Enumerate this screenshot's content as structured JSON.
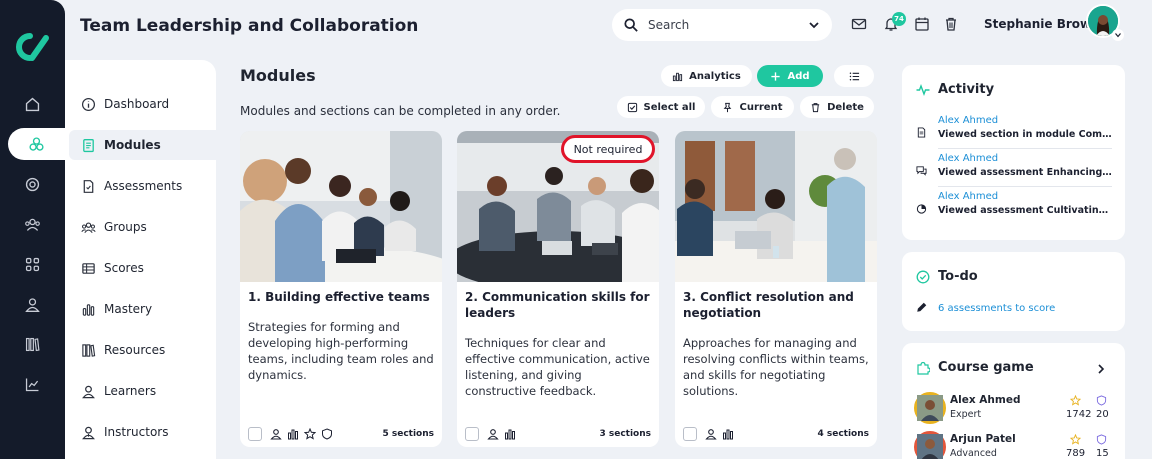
{
  "header": {
    "title": "Team Leadership and Collaboration",
    "search_placeholder": "Search",
    "notification_count": "74",
    "user_name": "Stephanie Brown"
  },
  "rail": {
    "items": [
      "home-icon",
      "modules-icon",
      "target-icon",
      "users-icon",
      "grid-icon",
      "person-icon",
      "library-icon",
      "chart-icon"
    ],
    "active": "modules-icon"
  },
  "subnav": {
    "items": [
      {
        "label": "Dashboard",
        "icon": "info-icon"
      },
      {
        "label": "Modules",
        "icon": "document-icon",
        "active": true
      },
      {
        "label": "Assessments",
        "icon": "assessment-icon"
      },
      {
        "label": "Groups",
        "icon": "groups-icon"
      },
      {
        "label": "Scores",
        "icon": "scores-icon"
      },
      {
        "label": "Mastery",
        "icon": "bars-icon"
      },
      {
        "label": "Resources",
        "icon": "books-icon"
      },
      {
        "label": "Learners",
        "icon": "user-icon"
      },
      {
        "label": "Instructors",
        "icon": "instructor-icon"
      }
    ]
  },
  "main": {
    "title": "Modules",
    "subtitle": "Modules and sections can be completed in any order.",
    "buttons": {
      "analytics": "Analytics",
      "add": "Add",
      "select_all": "Select all",
      "current": "Current",
      "delete": "Delete"
    },
    "cards": [
      {
        "title": "1. Building effective teams",
        "description": "Strategies for forming and developing high-performing teams, including team roles and dynamics.",
        "sections": "5 sections",
        "tag": ""
      },
      {
        "title": "2. Communication skills for leaders",
        "description": "Techniques for clear and effective communication, active listening, and giving constructive feedback.",
        "sections": "3 sections",
        "tag": "Not required"
      },
      {
        "title": "3. Conflict resolution and negotiation",
        "description": "Approaches for managing and resolving conflicts within teams, and skills for negotiating solutions.",
        "sections": "4 sections",
        "tag": ""
      }
    ]
  },
  "activity": {
    "title": "Activity",
    "items": [
      {
        "name": "Alex Ahmed",
        "description": "Viewed section in module Communication skills for leaders",
        "icon": "doc-icon"
      },
      {
        "name": "Alex Ahmed",
        "description": "Viewed assessment Enhancing communication",
        "icon": "chat-icon"
      },
      {
        "name": "Alex Ahmed",
        "description": "Viewed assessment Cultivating a positive team culture",
        "icon": "pie-icon"
      }
    ]
  },
  "todo": {
    "title": "To-do",
    "link": "6 assessments to score"
  },
  "game": {
    "title": "Course game",
    "players": [
      {
        "name": "Alex Ahmed",
        "level": "Expert",
        "points": "1742",
        "badges": "20",
        "ring": "#e8b21f"
      },
      {
        "name": "Arjun Patel",
        "level": "Advanced",
        "points": "789",
        "badges": "15",
        "ring": "#e2563b"
      }
    ]
  },
  "colors": {
    "accent": "#1fc7a0",
    "rail": "#141b2a",
    "link": "#1c8fd6",
    "highlight": "#e0142a"
  }
}
